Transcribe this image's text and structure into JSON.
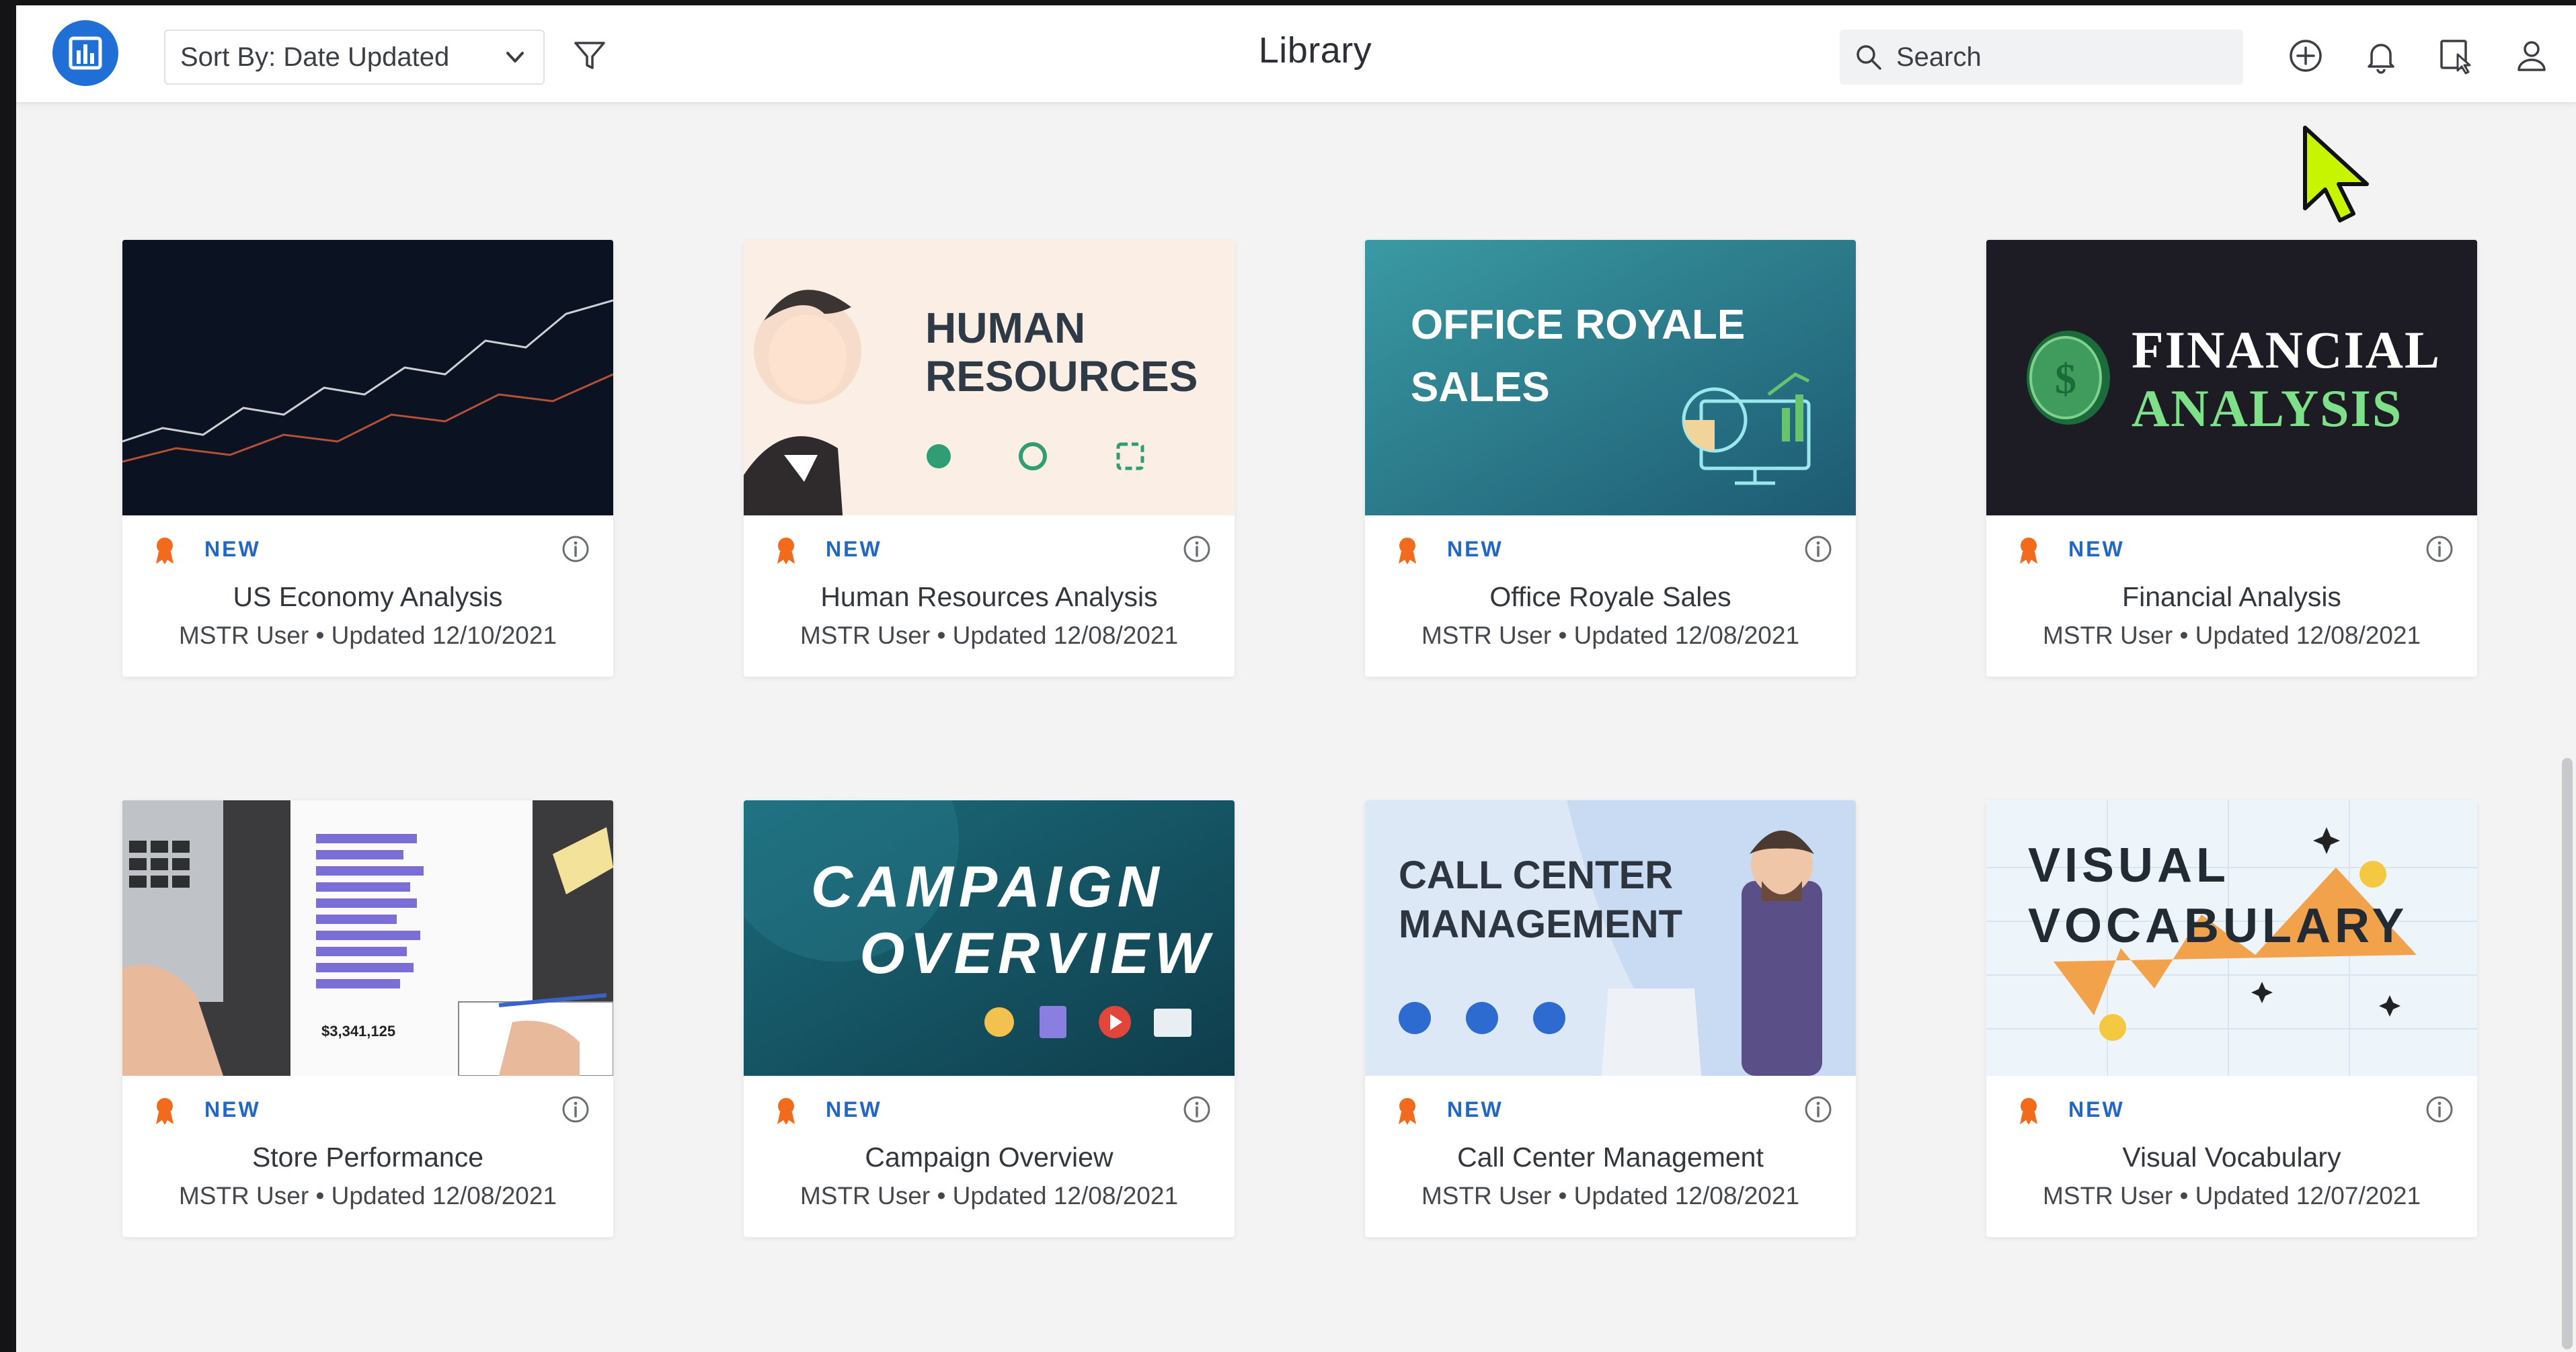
{
  "topbar": {
    "sort_label": "Sort By: Date Updated",
    "title": "Library",
    "search_placeholder": "Search"
  },
  "icons": {
    "logo": "bar-chart-logo-icon",
    "sort_chevron": "chevron-down-icon",
    "filter": "filter-icon",
    "search": "search-icon",
    "add": "plus-circle-icon",
    "notifications": "bell-icon",
    "multi_select": "select-cursor-icon",
    "account": "user-icon",
    "badge": "ribbon-badge-icon",
    "info": "info-icon"
  },
  "colors": {
    "accent": "#1f6fd6",
    "new_label": "#2367c4",
    "badge": "#f26b1d",
    "cursor": "#c7f500"
  },
  "cards": [
    {
      "title": "US Economy Analysis",
      "subtitle": "MSTR User • Updated 12/10/2021",
      "badge": "NEW",
      "thumb_text": []
    },
    {
      "title": "Human Resources Analysis",
      "subtitle": "MSTR User • Updated 12/08/2021",
      "badge": "NEW",
      "thumb_text": [
        "HUMAN",
        "RESOURCES"
      ]
    },
    {
      "title": "Office Royale Sales",
      "subtitle": "MSTR User • Updated 12/08/2021",
      "badge": "NEW",
      "thumb_text": [
        "OFFICE ROYALE",
        "SALES"
      ]
    },
    {
      "title": "Financial Analysis",
      "subtitle": "MSTR User • Updated 12/08/2021",
      "badge": "NEW",
      "thumb_text": [
        "FINANCIAL",
        "ANALYSIS"
      ]
    },
    {
      "title": "Store Performance",
      "subtitle": "MSTR User • Updated 12/08/2021",
      "badge": "NEW",
      "thumb_text": [
        "$3,341,125"
      ]
    },
    {
      "title": "Campaign Overview",
      "subtitle": "MSTR User • Updated 12/08/2021",
      "badge": "NEW",
      "thumb_text": [
        "CAMPAIGN",
        "OVERVIEW"
      ]
    },
    {
      "title": "Call Center Management",
      "subtitle": "MSTR User • Updated 12/08/2021",
      "badge": "NEW",
      "thumb_text": [
        "CALL CENTER",
        "MANAGEMENT"
      ]
    },
    {
      "title": "Visual Vocabulary",
      "subtitle": "MSTR User • Updated 12/07/2021",
      "badge": "NEW",
      "thumb_text": [
        "VISUAL",
        "VOCABULARY"
      ]
    }
  ]
}
